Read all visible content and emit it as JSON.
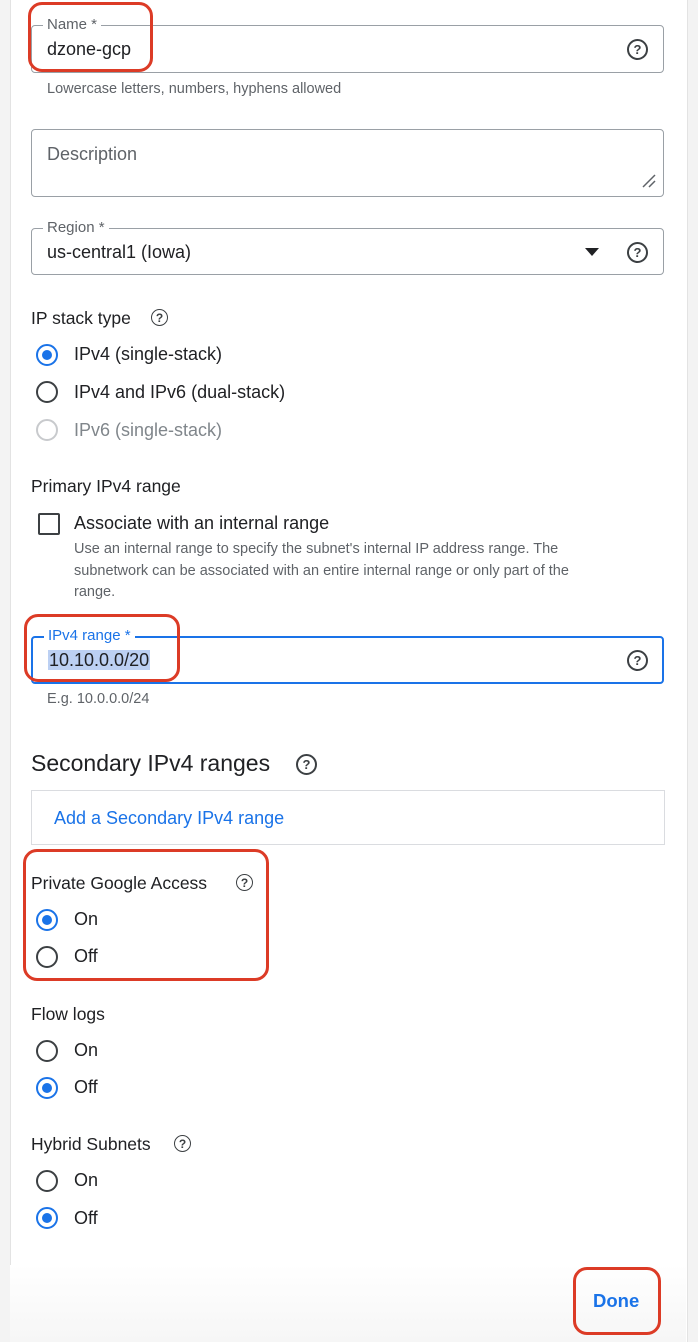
{
  "form": {
    "name": {
      "label": "Name *",
      "value": "dzone-gcp",
      "help": "Lowercase letters, numbers, hyphens allowed"
    },
    "description": {
      "placeholder": "Description"
    },
    "region": {
      "label": "Region *",
      "value": "us-central1 (Iowa)"
    },
    "ip_stack": {
      "title": "IP stack type",
      "options": [
        {
          "label": "IPv4 (single-stack)",
          "state": "checked"
        },
        {
          "label": "IPv4 and IPv6 (dual-stack)",
          "state": "unchecked"
        },
        {
          "label": "IPv6 (single-stack)",
          "state": "disabled"
        }
      ]
    },
    "primary_range": {
      "title": "Primary IPv4 range",
      "checkbox_label": "Associate with an internal range",
      "checkbox_help_lines": [
        "Use an internal range to specify the subnet's internal IP address range. The",
        "subnetwork can be associated with an entire internal range or only part of the",
        "range."
      ]
    },
    "ipv4_range": {
      "label": "IPv4 range *",
      "value": "10.10.0.0/20",
      "help": "E.g. 10.0.0.0/24"
    },
    "secondary": {
      "title": "Secondary IPv4 ranges",
      "add_label": "Add a Secondary IPv4 range"
    },
    "private_google_access": {
      "title": "Private Google Access",
      "options": [
        "On",
        "Off"
      ],
      "selected": "On"
    },
    "flow_logs": {
      "title": "Flow logs",
      "options": [
        "On",
        "Off"
      ],
      "selected": "Off"
    },
    "hybrid_subnets": {
      "title": "Hybrid Subnets",
      "options": [
        "On",
        "Off"
      ],
      "selected": "Off"
    },
    "done_label": "Done"
  },
  "icons": {
    "help": "help-circle-icon",
    "dropdown": "arrow-drop-down-icon",
    "resize": "resize-handle-icon"
  },
  "colors": {
    "accent": "#1a73e8",
    "annotation": "#dc3b26",
    "text": "#202124",
    "muted": "#5f6368"
  }
}
